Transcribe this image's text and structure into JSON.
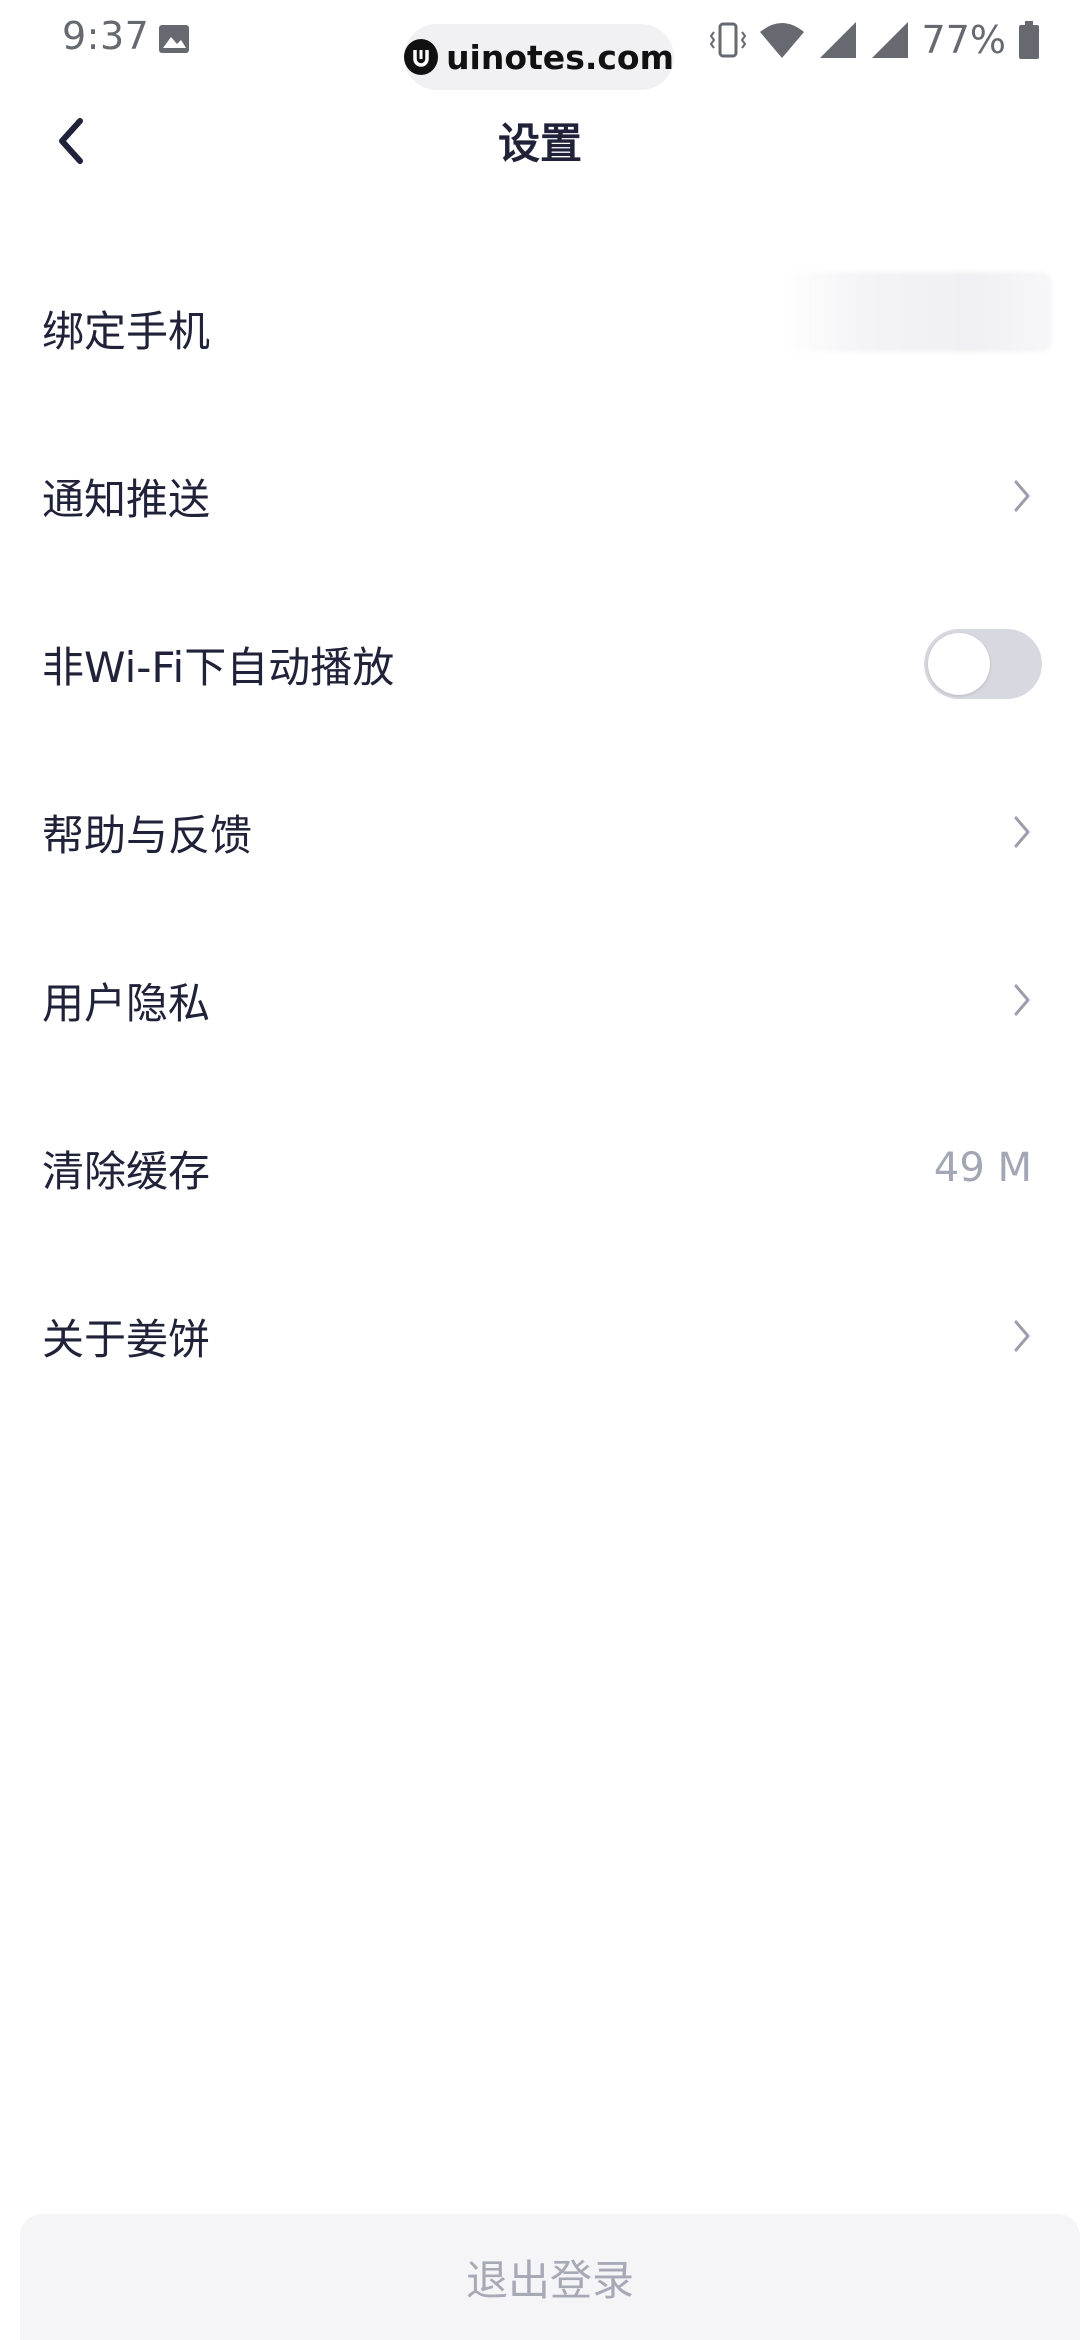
{
  "status_bar": {
    "time": "9:37",
    "battery": "77%",
    "icons": [
      "image-icon",
      "vibrate-icon",
      "wifi-icon",
      "signal-icon",
      "signal-icon",
      "battery-icon"
    ]
  },
  "watermark": {
    "text": "uinotes.com"
  },
  "header": {
    "title": "设置",
    "back_icon": "chevron-left-icon"
  },
  "settings": {
    "bind_phone": {
      "label": "绑定手机"
    },
    "notifications": {
      "label": "通知推送"
    },
    "autoplay": {
      "label": "非Wi-Fi下自动播放",
      "enabled": false
    },
    "help": {
      "label": "帮助与反馈"
    },
    "privacy": {
      "label": "用户隐私"
    },
    "cache": {
      "label": "清除缓存",
      "value": "49 M"
    },
    "about": {
      "label": "关于姜饼"
    }
  },
  "logout": {
    "label": "退出登录"
  },
  "colors": {
    "text_primary": "#1f2238",
    "text_secondary": "#a3a6b4",
    "toggle_off": "#d8d9e0",
    "logout_bg": "#f5f5f8"
  }
}
